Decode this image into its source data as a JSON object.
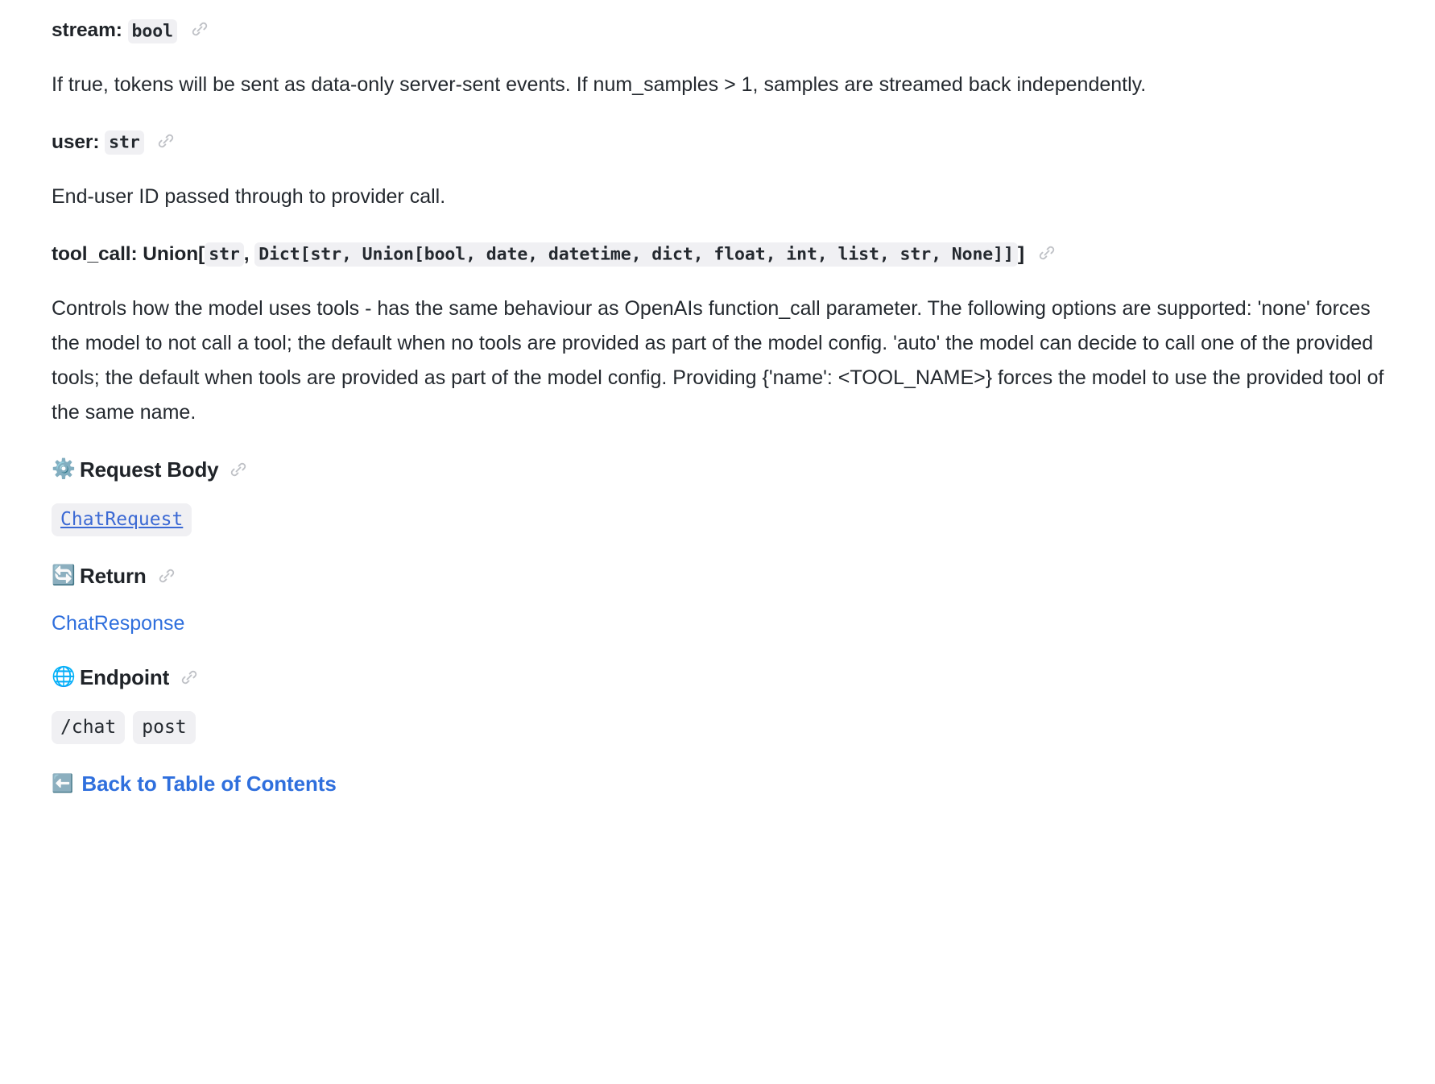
{
  "doc": {
    "params": [
      {
        "name": "stream:",
        "type_chip": "bool",
        "anchor_icon": "link-icon",
        "description": "If true, tokens will be sent as data-only server-sent events. If num_samples > 1, samples are streamed back independently."
      },
      {
        "name": "user:",
        "type_chip": "str",
        "anchor_icon": "link-icon",
        "description": "End-user ID passed through to provider call."
      }
    ],
    "tool_call": {
      "name": "tool_call:",
      "sig_prefix": "Union[",
      "chip_1": "str",
      "sig_comma": ",",
      "chip_2": "Dict[str, Union[bool, date, datetime, dict, float, int, list, str, None]]",
      "sig_suffix": "]",
      "anchor_icon": "link-icon",
      "description": "Controls how the model uses tools - has the same behaviour as OpenAIs function_call parameter. The following options are supported: 'none' forces the model to not call a tool; the default when no tools are provided as part of the model config. 'auto' the model can decide to call one of the provided tools; the default when tools are provided as part of the model config. Providing {'name': <TOOL_NAME>} forces the model to use the provided tool of the same name."
    },
    "sections": [
      {
        "id": "request-body",
        "emoji": "⚙️",
        "emoji_name": "gear-icon",
        "title": "Request Body",
        "anchor_icon": "link-icon",
        "chips": [
          {
            "text": "ChatRequest",
            "style": "link"
          }
        ]
      },
      {
        "id": "return",
        "emoji": "🔄",
        "emoji_name": "refresh-icon",
        "title": "Return",
        "anchor_icon": "link-icon",
        "link_text": "ChatResponse"
      },
      {
        "id": "endpoint",
        "emoji": "🌐",
        "emoji_name": "globe-icon",
        "title": "Endpoint",
        "anchor_icon": "link-icon",
        "chips": [
          {
            "text": "/chat",
            "style": "plain"
          },
          {
            "text": "post",
            "style": "plain"
          }
        ]
      }
    ],
    "footer": {
      "back_emoji": "⬅️",
      "back_emoji_name": "back-arrow-icon",
      "back_label": "Back to Table of Contents"
    },
    "colors": {
      "link_blue": "#2f6fdd",
      "code_link_blue": "#3b69d4",
      "chip_bg": "#f0f0f3",
      "text": "#24292f"
    }
  }
}
